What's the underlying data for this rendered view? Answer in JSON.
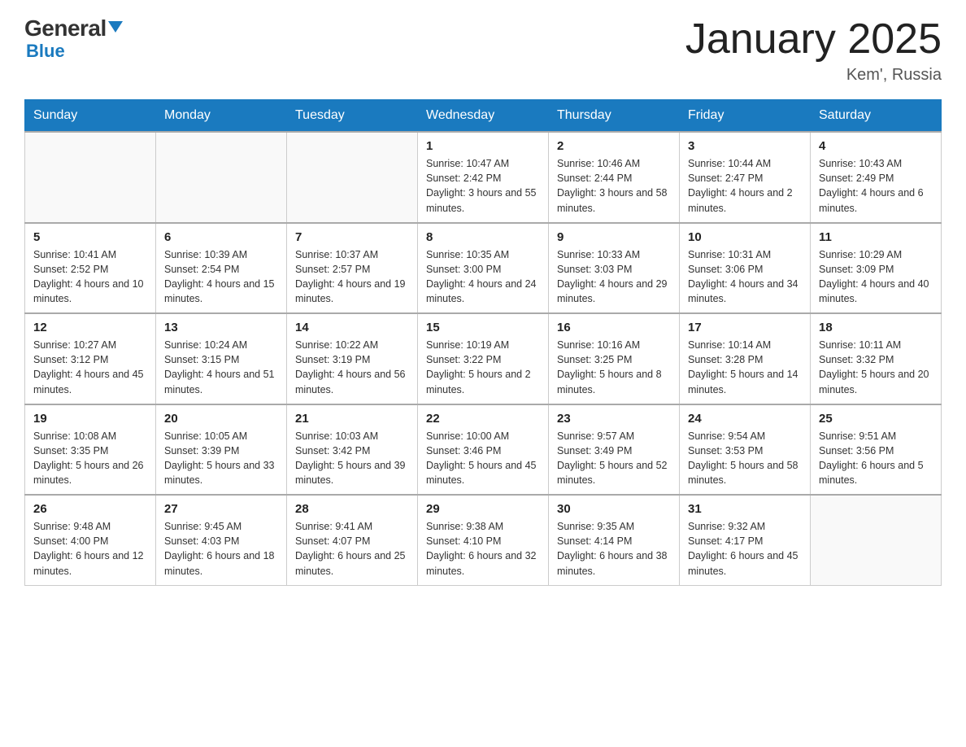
{
  "logo": {
    "general": "General",
    "blue": "Blue",
    "triangle": true
  },
  "header": {
    "title": "January 2025",
    "subtitle": "Kem', Russia"
  },
  "weekdays": [
    "Sunday",
    "Monday",
    "Tuesday",
    "Wednesday",
    "Thursday",
    "Friday",
    "Saturday"
  ],
  "weeks": [
    [
      {
        "day": "",
        "info": ""
      },
      {
        "day": "",
        "info": ""
      },
      {
        "day": "",
        "info": ""
      },
      {
        "day": "1",
        "info": "Sunrise: 10:47 AM\nSunset: 2:42 PM\nDaylight: 3 hours\nand 55 minutes."
      },
      {
        "day": "2",
        "info": "Sunrise: 10:46 AM\nSunset: 2:44 PM\nDaylight: 3 hours\nand 58 minutes."
      },
      {
        "day": "3",
        "info": "Sunrise: 10:44 AM\nSunset: 2:47 PM\nDaylight: 4 hours\nand 2 minutes."
      },
      {
        "day": "4",
        "info": "Sunrise: 10:43 AM\nSunset: 2:49 PM\nDaylight: 4 hours\nand 6 minutes."
      }
    ],
    [
      {
        "day": "5",
        "info": "Sunrise: 10:41 AM\nSunset: 2:52 PM\nDaylight: 4 hours\nand 10 minutes."
      },
      {
        "day": "6",
        "info": "Sunrise: 10:39 AM\nSunset: 2:54 PM\nDaylight: 4 hours\nand 15 minutes."
      },
      {
        "day": "7",
        "info": "Sunrise: 10:37 AM\nSunset: 2:57 PM\nDaylight: 4 hours\nand 19 minutes."
      },
      {
        "day": "8",
        "info": "Sunrise: 10:35 AM\nSunset: 3:00 PM\nDaylight: 4 hours\nand 24 minutes."
      },
      {
        "day": "9",
        "info": "Sunrise: 10:33 AM\nSunset: 3:03 PM\nDaylight: 4 hours\nand 29 minutes."
      },
      {
        "day": "10",
        "info": "Sunrise: 10:31 AM\nSunset: 3:06 PM\nDaylight: 4 hours\nand 34 minutes."
      },
      {
        "day": "11",
        "info": "Sunrise: 10:29 AM\nSunset: 3:09 PM\nDaylight: 4 hours\nand 40 minutes."
      }
    ],
    [
      {
        "day": "12",
        "info": "Sunrise: 10:27 AM\nSunset: 3:12 PM\nDaylight: 4 hours\nand 45 minutes."
      },
      {
        "day": "13",
        "info": "Sunrise: 10:24 AM\nSunset: 3:15 PM\nDaylight: 4 hours\nand 51 minutes."
      },
      {
        "day": "14",
        "info": "Sunrise: 10:22 AM\nSunset: 3:19 PM\nDaylight: 4 hours\nand 56 minutes."
      },
      {
        "day": "15",
        "info": "Sunrise: 10:19 AM\nSunset: 3:22 PM\nDaylight: 5 hours\nand 2 minutes."
      },
      {
        "day": "16",
        "info": "Sunrise: 10:16 AM\nSunset: 3:25 PM\nDaylight: 5 hours\nand 8 minutes."
      },
      {
        "day": "17",
        "info": "Sunrise: 10:14 AM\nSunset: 3:28 PM\nDaylight: 5 hours\nand 14 minutes."
      },
      {
        "day": "18",
        "info": "Sunrise: 10:11 AM\nSunset: 3:32 PM\nDaylight: 5 hours\nand 20 minutes."
      }
    ],
    [
      {
        "day": "19",
        "info": "Sunrise: 10:08 AM\nSunset: 3:35 PM\nDaylight: 5 hours\nand 26 minutes."
      },
      {
        "day": "20",
        "info": "Sunrise: 10:05 AM\nSunset: 3:39 PM\nDaylight: 5 hours\nand 33 minutes."
      },
      {
        "day": "21",
        "info": "Sunrise: 10:03 AM\nSunset: 3:42 PM\nDaylight: 5 hours\nand 39 minutes."
      },
      {
        "day": "22",
        "info": "Sunrise: 10:00 AM\nSunset: 3:46 PM\nDaylight: 5 hours\nand 45 minutes."
      },
      {
        "day": "23",
        "info": "Sunrise: 9:57 AM\nSunset: 3:49 PM\nDaylight: 5 hours\nand 52 minutes."
      },
      {
        "day": "24",
        "info": "Sunrise: 9:54 AM\nSunset: 3:53 PM\nDaylight: 5 hours\nand 58 minutes."
      },
      {
        "day": "25",
        "info": "Sunrise: 9:51 AM\nSunset: 3:56 PM\nDaylight: 6 hours\nand 5 minutes."
      }
    ],
    [
      {
        "day": "26",
        "info": "Sunrise: 9:48 AM\nSunset: 4:00 PM\nDaylight: 6 hours\nand 12 minutes."
      },
      {
        "day": "27",
        "info": "Sunrise: 9:45 AM\nSunset: 4:03 PM\nDaylight: 6 hours\nand 18 minutes."
      },
      {
        "day": "28",
        "info": "Sunrise: 9:41 AM\nSunset: 4:07 PM\nDaylight: 6 hours\nand 25 minutes."
      },
      {
        "day": "29",
        "info": "Sunrise: 9:38 AM\nSunset: 4:10 PM\nDaylight: 6 hours\nand 32 minutes."
      },
      {
        "day": "30",
        "info": "Sunrise: 9:35 AM\nSunset: 4:14 PM\nDaylight: 6 hours\nand 38 minutes."
      },
      {
        "day": "31",
        "info": "Sunrise: 9:32 AM\nSunset: 4:17 PM\nDaylight: 6 hours\nand 45 minutes."
      },
      {
        "day": "",
        "info": ""
      }
    ]
  ]
}
